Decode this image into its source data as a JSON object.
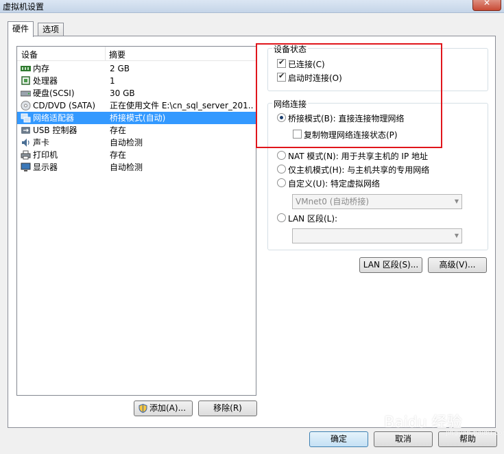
{
  "window": {
    "title": "虚拟机设置",
    "close_label": "✕"
  },
  "tabs": [
    {
      "label": "硬件"
    },
    {
      "label": "选项"
    }
  ],
  "device_list": {
    "header_device": "设备",
    "header_summary": "摘要",
    "rows": [
      {
        "name": "内存",
        "summary": "2 GB",
        "icon": "memory-icon"
      },
      {
        "name": "处理器",
        "summary": "1",
        "icon": "processor-icon"
      },
      {
        "name": "硬盘(SCSI)",
        "summary": "30 GB",
        "icon": "harddisk-icon"
      },
      {
        "name": "CD/DVD (SATA)",
        "summary": "正在使用文件 E:\\cn_sql_server_201...",
        "icon": "cd-dvd-icon"
      },
      {
        "name": "网络适配器",
        "summary": "桥接模式(自动)",
        "icon": "network-adapter-icon"
      },
      {
        "name": "USB 控制器",
        "summary": "存在",
        "icon": "usb-icon"
      },
      {
        "name": "声卡",
        "summary": "自动检测",
        "icon": "sound-icon"
      },
      {
        "name": "打印机",
        "summary": "存在",
        "icon": "printer-icon"
      },
      {
        "name": "显示器",
        "summary": "自动检测",
        "icon": "display-icon"
      }
    ],
    "selected_index": 4
  },
  "buttons": {
    "add": "添加(A)...",
    "remove": "移除(R)",
    "lan_segments": "LAN 区段(S)...",
    "advanced": "高级(V)...",
    "ok": "确定",
    "cancel": "取消",
    "help": "帮助"
  },
  "device_status": {
    "group_label": "设备状态",
    "connected": {
      "label": "已连接(C)",
      "checked": true
    },
    "connect_at_power_on": {
      "label": "启动时连接(O)",
      "checked": true
    }
  },
  "network_connection": {
    "group_label": "网络连接",
    "bridged": {
      "label": "桥接模式(B): 直接连接物理网络",
      "selected": true
    },
    "replicate": {
      "label": "复制物理网络连接状态(P)",
      "checked": false
    },
    "nat": {
      "label": "NAT 模式(N): 用于共享主机的 IP 地址",
      "selected": false
    },
    "host_only": {
      "label": "仅主机模式(H): 与主机共享的专用网络",
      "selected": false
    },
    "custom": {
      "label": "自定义(U): 特定虚拟网络",
      "selected": false
    },
    "custom_combo_value": "VMnet0 (自动桥接)",
    "lan_segment": {
      "label": "LAN 区段(L):",
      "selected": false
    },
    "lan_combo_value": ""
  },
  "watermark": {
    "text": "Baidu 经验",
    "subtext": "jingyan.baidu.com"
  },
  "colors": {
    "selection": "#3399ff",
    "highlight_box": "#e0151b"
  }
}
